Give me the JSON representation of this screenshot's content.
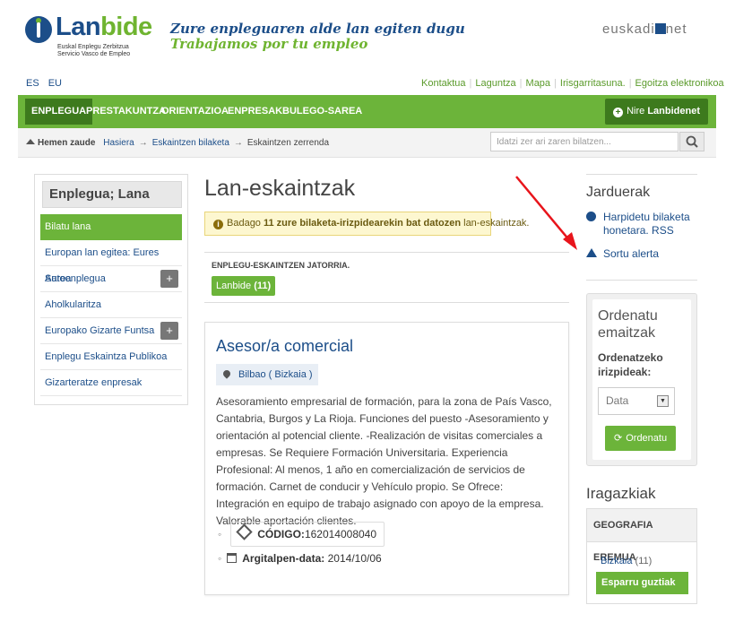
{
  "header": {
    "brand_part1": "Lan",
    "brand_part2": "bide",
    "sub1": "Euskal Enplegu Zerbitzua",
    "sub2": "Servicio Vasco de Empleo",
    "slogan_eu": "Zure enpleguaren alde lan egiten dugu",
    "slogan_es": "Trabajamos por tu empleo",
    "euskadi_part1": "euskadi",
    "euskadi_part2": "net"
  },
  "langs": [
    "ES",
    "EU"
  ],
  "toplinks": [
    "Kontaktua",
    "Laguntza",
    "Mapa",
    "Irisgarritasuna.",
    "Egoitza elektronikoa"
  ],
  "nav": {
    "items": [
      "ENPLEGUA",
      "PRESTAKUNTZA",
      "ORIENTAZIOA",
      "ENPRESAK",
      "BULEGO-SAREA"
    ],
    "nire_prefix": "Nire ",
    "nire_bold": "Lanbidenet"
  },
  "breadcrumb": {
    "label": "Hemen zaude",
    "items": [
      "Hasiera",
      "Eskaintzen bilaketa",
      "Eskaintzen zerrenda"
    ]
  },
  "search": {
    "placeholder": "Idatzi zer ari zaren bilatzen..."
  },
  "sidebar": {
    "title": "Enplegua; Lana",
    "items": [
      {
        "label": "Bilatu lana"
      },
      {
        "label": "Europan lan egitea: Eures Sarea"
      },
      {
        "label": "Autoenplegua",
        "plus": "+"
      },
      {
        "label": "Aholkularitza"
      },
      {
        "label": "Europako Gizarte Funtsa",
        "plus": "+"
      },
      {
        "label": "Enplegu Eskaintza Publikoa"
      },
      {
        "label": "Gizarteratze enpresak"
      }
    ]
  },
  "main": {
    "title": "Lan-eskaintzak",
    "alert_pre": "Badago ",
    "alert_bold": "11 zure bilaketa-irizpidearekin bat datozen",
    "alert_post": " lan-eskaintzak.",
    "source_label": "ENPLEGU-ESKAINTZEN JATORRIA.",
    "source_tag": "Lanbide",
    "source_count": "(11)",
    "offer": {
      "title": "Asesor/a comercial",
      "location": "Bilbao ( Bizkaia )",
      "description": "Asesoramiento empresarial de formación, para la zona de País Vasco, Cantabria, Burgos y La Rioja. Funciones del puesto -Asesoramiento y orientación al potencial cliente. -Realización de visitas comerciales a empresas. Se Requiere Formación Universitaria. Experiencia Profesional: Al menos, 1 año en comercialización de servicios de formación. Carnet de conducir y Vehículo propio. Se Ofrece: Integración en equipo de trabajo asignado con apoyo de la empresa. Valorable aportación clientes.",
      "code_label": "CÓDIGO:",
      "code_value": "162014008040",
      "date_label": "Argitalpen-data:",
      "date_value": "2014/10/06"
    }
  },
  "right": {
    "actions_title": "Jarduerak",
    "rss": "Harpidetu bilaketa honetara. RSS",
    "alert": "Sortu alerta",
    "sort_title": "Ordenatu emaitzak",
    "sort_label": "Ordenatzeko irizpideak:",
    "sort_value": "Data",
    "sort_button": "Ordenatu",
    "filters_title": "Iragazkiak",
    "geo_title": "GEOGRAFIA EREMUA",
    "geo_item": "Bizkaia",
    "geo_count": "(11)",
    "geo_clear": "Esparru guztiak"
  },
  "colors": {
    "brand_green": "#6cb43a",
    "dark_green": "#3d7a1d",
    "link_blue": "#1c4e89",
    "annotation_red": "#e8141b"
  }
}
